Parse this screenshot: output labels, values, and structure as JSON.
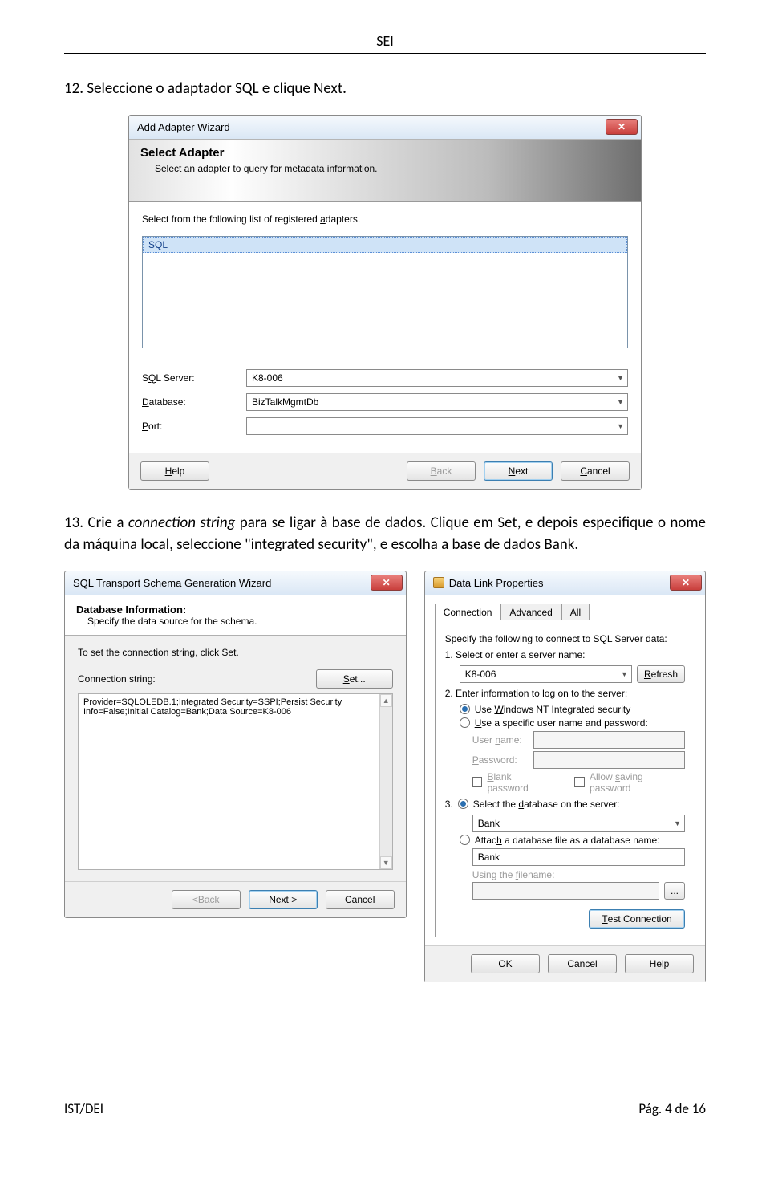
{
  "doc": {
    "header": "SEI",
    "step12": "12. Seleccione o adaptador SQL e clique Next.",
    "step13_a": "13. Crie a ",
    "step13_i1": "connection string",
    "step13_b": " para se ligar à base de dados. Clique em Set, e depois especifique o nome da máquina local, seleccione \"integrated security\", e escolha a base de dados Bank.",
    "footer_left": "IST/DEI",
    "footer_right": "Pág. 4 de 16"
  },
  "wiz1": {
    "title": "Add Adapter Wizard",
    "banner_title": "Select Adapter",
    "banner_sub": "Select an adapter to query for metadata information.",
    "list_label_a": "Select from the following list of registered ",
    "list_label_u": "a",
    "list_label_b": "dapters.",
    "item": "SQL",
    "row_server_a": "S",
    "row_server_u": "Q",
    "row_server_b": "L Server:",
    "row_db_u": "D",
    "row_db_b": "atabase:",
    "row_port_u": "P",
    "row_port_b": "ort:",
    "val_server": "K8-006",
    "val_db": "BizTalkMgmtDb",
    "val_port": "",
    "help_u": "H",
    "help_b": "elp",
    "back_u": "B",
    "back_b": "ack",
    "next_u": "N",
    "next_b": "ext",
    "cancel_u": "C",
    "cancel_b": "ancel"
  },
  "wiz2": {
    "title": "SQL Transport Schema Generation Wizard",
    "banner_title": "Database Information:",
    "banner_sub": "Specify the data source for the schema.",
    "prompt": "To set the connection string, click Set.",
    "lbl_conn": "Connection string:",
    "set_u": "S",
    "set_b": "et...",
    "conn_value": "Provider=SQLOLEDB.1;Integrated Security=SSPI;Persist Security Info=False;Initial Catalog=Bank;Data Source=K8-006",
    "back_pre": "< ",
    "back_u": "B",
    "back_b": "ack",
    "next_u": "N",
    "next_b": "ext >",
    "cancel": "Cancel"
  },
  "dlg": {
    "title": "Data Link Properties",
    "tab1": "Connection",
    "tab2": "Advanced",
    "tab3": "All",
    "intro": "Specify the following to connect to SQL Server data:",
    "n1": "1. Select or enter a server name:",
    "server": "K8-006",
    "refresh_u": "R",
    "refresh_b": "efresh",
    "n2": "2. Enter information to log on to the server:",
    "r_nt_a": "Use ",
    "r_nt_u": "W",
    "r_nt_b": "indows NT Integrated security",
    "r_sp_u": "U",
    "r_sp_b": "se a specific user name and password:",
    "lbl_user_a": "User ",
    "lbl_user_u": "n",
    "lbl_user_b": "ame:",
    "lbl_pass_u": "P",
    "lbl_pass_b": "assword:",
    "cb_blank_u": "B",
    "cb_blank_b": "lank password",
    "cb_allow_a": "Allow ",
    "cb_allow_u": "s",
    "cb_allow_b": "aving password",
    "n3_pre": "3.",
    "r_db_a": "Select the ",
    "r_db_u": "d",
    "r_db_b": "atabase on the server:",
    "db": "Bank",
    "r_attach_a": "Attac",
    "r_attach_u": "h",
    "r_attach_b": " a database file as a database name:",
    "attach_name": "Bank",
    "lbl_filename_a": "Using the ",
    "lbl_filename_u": "f",
    "lbl_filename_b": "ilename:",
    "browse": "...",
    "test_u": "T",
    "test_b": "est Connection",
    "ok": "OK",
    "cancel": "Cancel",
    "help": "Help"
  }
}
